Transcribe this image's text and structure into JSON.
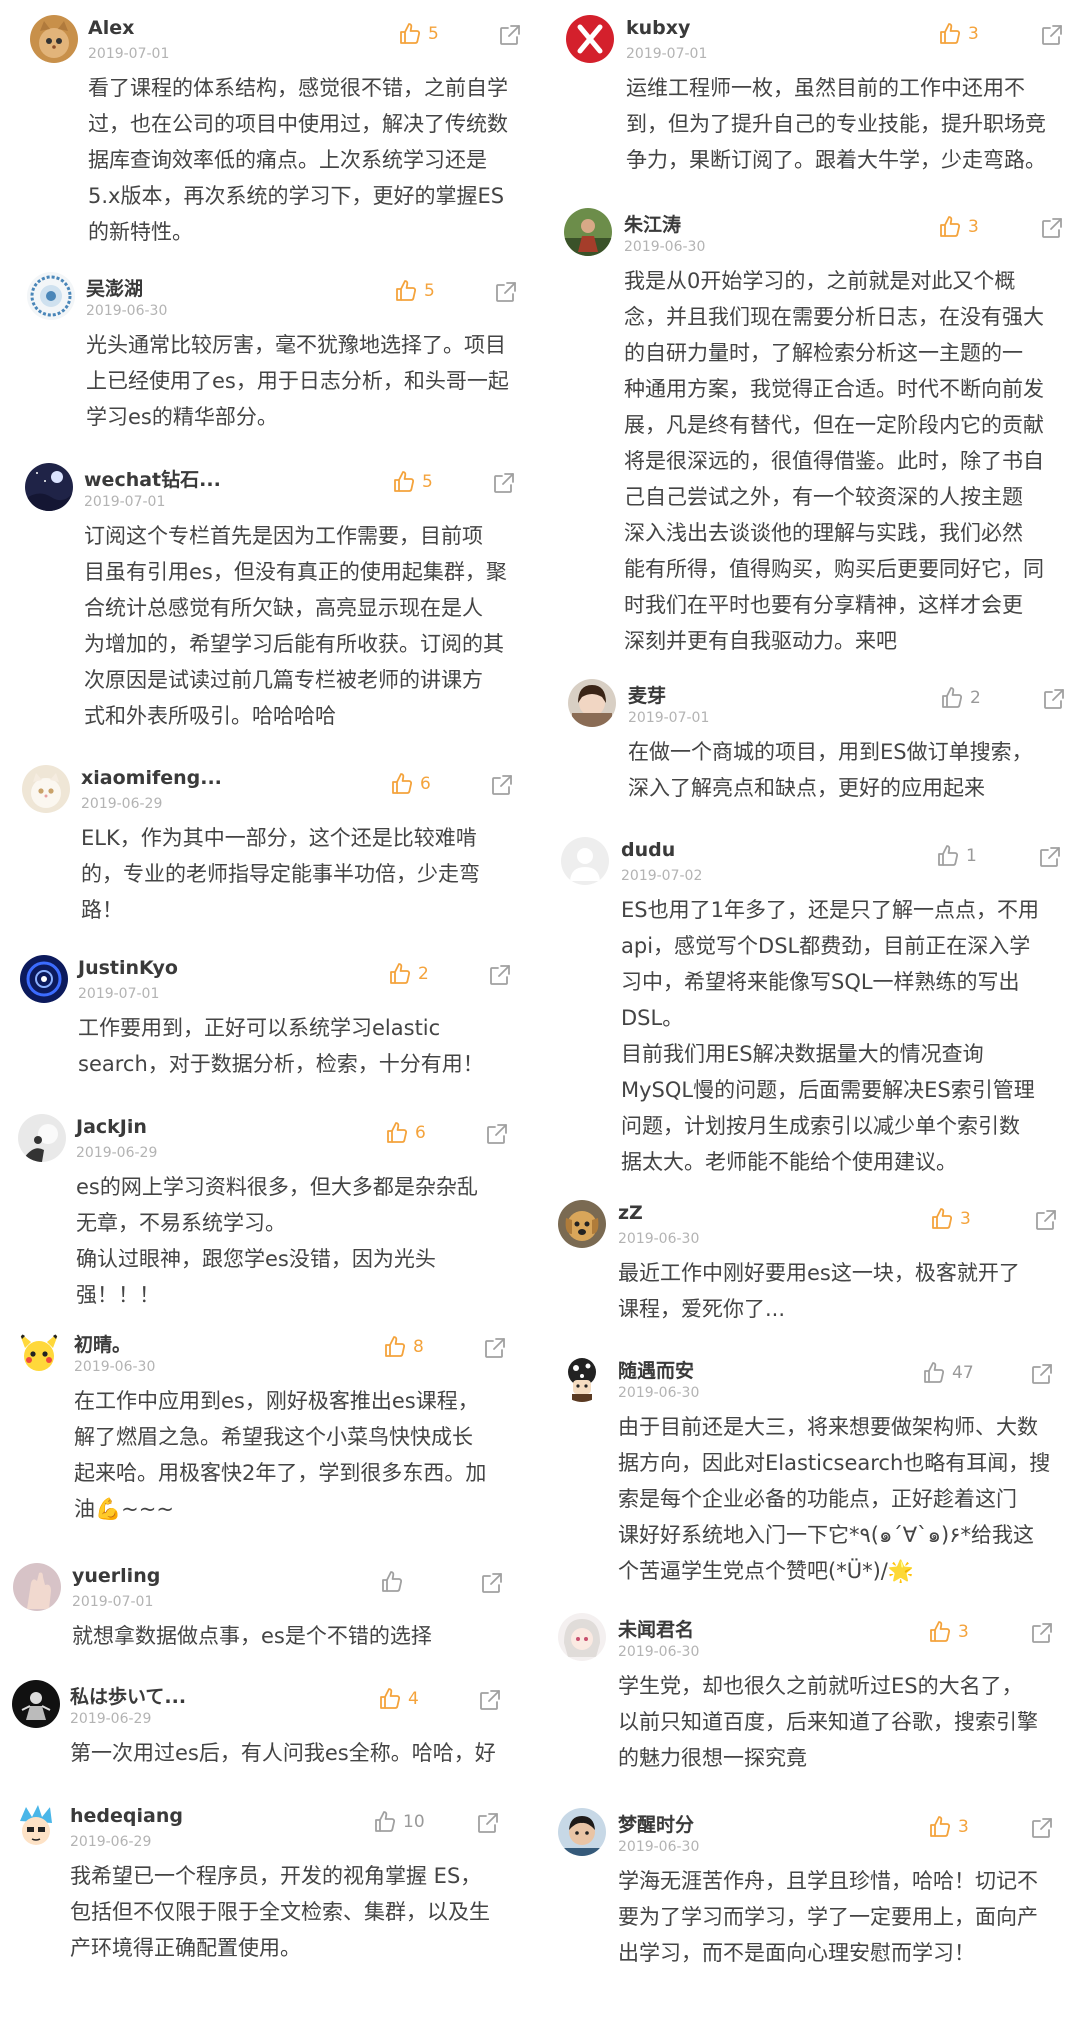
{
  "colors": {
    "like_active": "#f4a33c",
    "like_inactive": "#a0a0a0",
    "share": "#a0a0a0",
    "name": "#3a3a3a",
    "date": "#b3b3b3",
    "text": "#444444"
  },
  "left_column": [
    {
      "name": "Alex",
      "date": "2019-07-01",
      "likes": "5",
      "liked": true,
      "avatar": "cat-avatar",
      "lines": [
        "看了课程的体系结构，感觉很不错，之前自学",
        "过，也在公司的项目中使用过，解决了传统数",
        "据库查询效率低的痛点。上次系统学习还是",
        "5.x版本，再次系统的学习下，更好的掌握ES",
        "的新特性。"
      ]
    },
    {
      "name": "吴澎湖",
      "date": "2019-06-30",
      "likes": "5",
      "liked": true,
      "avatar": "badge-avatar",
      "lines": [
        "光头通常比较厉害，毫不犹豫地选择了。项目",
        "上已经使用了es，用于日志分析，和头哥一起",
        "学习es的精华部分。"
      ]
    },
    {
      "name": "wechat钻石...",
      "date": "2019-07-01",
      "likes": "5",
      "liked": true,
      "avatar": "night-sky-avatar",
      "lines": [
        "订阅这个专栏首先是因为工作需要，目前项",
        "目虽有引用es，但没有真正的使用起集群，聚",
        "合统计总感觉有所欠缺，高亮显示现在是人",
        "为增加的，希望学习后能有所收获。订阅的其",
        "次原因是试读过前几篇专栏被老师的讲课方",
        "式和外表所吸引。哈哈哈哈"
      ]
    },
    {
      "name": "xiaomifeng...",
      "date": "2019-06-29",
      "likes": "6",
      "liked": true,
      "avatar": "kitten-avatar",
      "lines": [
        "ELK，作为其中一部分，这个还是比较难啃",
        "的，专业的老师指导定能事半功倍，少走弯",
        "路！"
      ]
    },
    {
      "name": "JustinKyo",
      "date": "2019-07-01",
      "likes": "2",
      "liked": true,
      "avatar": "tunnel-avatar",
      "lines": [
        "工作要用到，正好可以系统学习elastic",
        "search，对于数据分析，检索，十分有用！"
      ]
    },
    {
      "name": "JackJin",
      "date": "2019-06-29",
      "likes": "6",
      "liked": true,
      "avatar": "silhouette-avatar",
      "lines": [
        "es的网上学习资料很多，但大多都是杂杂乱",
        "无章，不易系统学习。",
        "确认过眼神，跟您学es没错，因为光头",
        "强！！！"
      ]
    },
    {
      "name": "初晴。",
      "date": "2019-06-30",
      "likes": "8",
      "liked": true,
      "avatar": "pikachu-avatar",
      "lines": [
        "在工作中应用到es，刚好极客推出es课程，",
        "解了燃眉之急。希望我这个小菜鸟快快成长",
        "起来哈。用极客快2年了，学到很多东西。加",
        "油💪~~~"
      ]
    },
    {
      "name": "yuerling",
      "date": "2019-07-01",
      "likes": "",
      "liked": false,
      "avatar": "hand-avatar",
      "lines": [
        "就想拿数据做点事，es是个不错的选择"
      ]
    },
    {
      "name": "私は歩いて...",
      "date": "2019-06-29",
      "likes": "4",
      "liked": true,
      "avatar": "dark-avatar",
      "lines": [
        "第一次用过es后，有人问我es全称。哈哈，好"
      ]
    },
    {
      "name": "hedeqiang",
      "date": "2019-06-29",
      "likes": "10",
      "liked": false,
      "avatar": "cartoon-avatar",
      "lines": [
        "我希望已一个程序员，开发的视角掌握 ES，",
        "包括但不仅限于限于全文检索、集群，以及生",
        "产环境得正确配置使用。"
      ]
    }
  ],
  "right_column": [
    {
      "name": "kubxy",
      "date": "2019-07-01",
      "likes": "3",
      "liked": true,
      "avatar": "red-x-avatar",
      "lines": [
        "运维工程师一枚，虽然目前的工作中还用不",
        "到，但为了提升自己的专业技能，提升职场竞",
        "争力，果断订阅了。跟着大牛学，少走弯路。"
      ]
    },
    {
      "name": "朱江涛",
      "date": "2019-06-30",
      "likes": "3",
      "liked": true,
      "avatar": "outdoor-avatar",
      "lines": [
        "我是从0开始学习的，之前就是对此又个概",
        "念，并且我们现在需要分析日志，在没有强大",
        "的自研力量时，了解检索分析这一主题的一",
        "种通用方案，我觉得正合适。时代不断向前发",
        "展，凡是终有替代，但在一定阶段内它的贡献",
        "将是很深远的，很值得借鉴。此时，除了书自",
        "己自己尝试之外，有一个较资深的人按主题",
        "深入浅出去谈谈他的理解与实践，我们必然",
        "能有所得，值得购买，购买后更要同好它，同",
        "时我们在平时也要有分享精神，这样才会更",
        "深刻并更有自我驱动力。来吧"
      ]
    },
    {
      "name": "麦芽",
      "date": "2019-07-01",
      "likes": "2",
      "liked": false,
      "avatar": "girl-avatar",
      "lines": [
        "在做一个商城的项目，用到ES做订单搜索，",
        "深入了解亮点和缺点，更好的应用起来"
      ]
    },
    {
      "name": "dudu",
      "date": "2019-07-02",
      "likes": "1",
      "liked": false,
      "avatar": "default-avatar",
      "lines": [
        "ES也用了1年多了，还是只了解一点点，不用",
        "api，感觉写个DSL都费劲，目前正在深入学",
        "习中，希望将来能像写SQL一样熟练的写出",
        "DSL。",
        "目前我们用ES解决数据量大的情况查询",
        "MySQL慢的问题，后面需要解决ES索引管理",
        "问题，计划按月生成索引以减少单个索引数",
        "据太大。老师能不能给个使用建议。"
      ]
    },
    {
      "name": "zZ",
      "date": "2019-06-30",
      "likes": "3",
      "liked": true,
      "avatar": "dog-avatar",
      "lines": [
        "最近工作中刚好要用es这一块，极客就开了",
        "课程，爱死你了..."
      ]
    },
    {
      "name": "随遇而安",
      "date": "2019-06-30",
      "likes": "47",
      "liked": false,
      "avatar": "mushroom-avatar",
      "lines": [
        "由于目前还是大三，将来想要做架构师、大数",
        "据方向，因此对Elasticsearch也略有耳闻，搜",
        "索是每个企业必备的功能点，正好趁着这门",
        "课好好系统地入门一下它*٩(๑´∀`๑)۶*给我这",
        "个苦逼学生党点个赞吧(*Ü*)/🌟"
      ]
    },
    {
      "name": "未闻君名",
      "date": "2019-06-30",
      "likes": "3",
      "liked": true,
      "avatar": "anime-avatar",
      "lines": [
        "学生党，却也很久之前就听过ES的大名了，",
        "以前只知道百度，后来知道了谷歌，搜索引擎",
        "的魅力很想一探究竟"
      ]
    },
    {
      "name": "梦醒时分",
      "date": "2019-06-30",
      "likes": "3",
      "liked": true,
      "avatar": "boy-avatar",
      "lines": [
        "学海无涯苦作舟，且学且珍惜，哈哈！切记不",
        "要为了学习而学习，学了一定要用上，面向产",
        "出学习，而不是面向心理安慰而学习！"
      ]
    }
  ]
}
